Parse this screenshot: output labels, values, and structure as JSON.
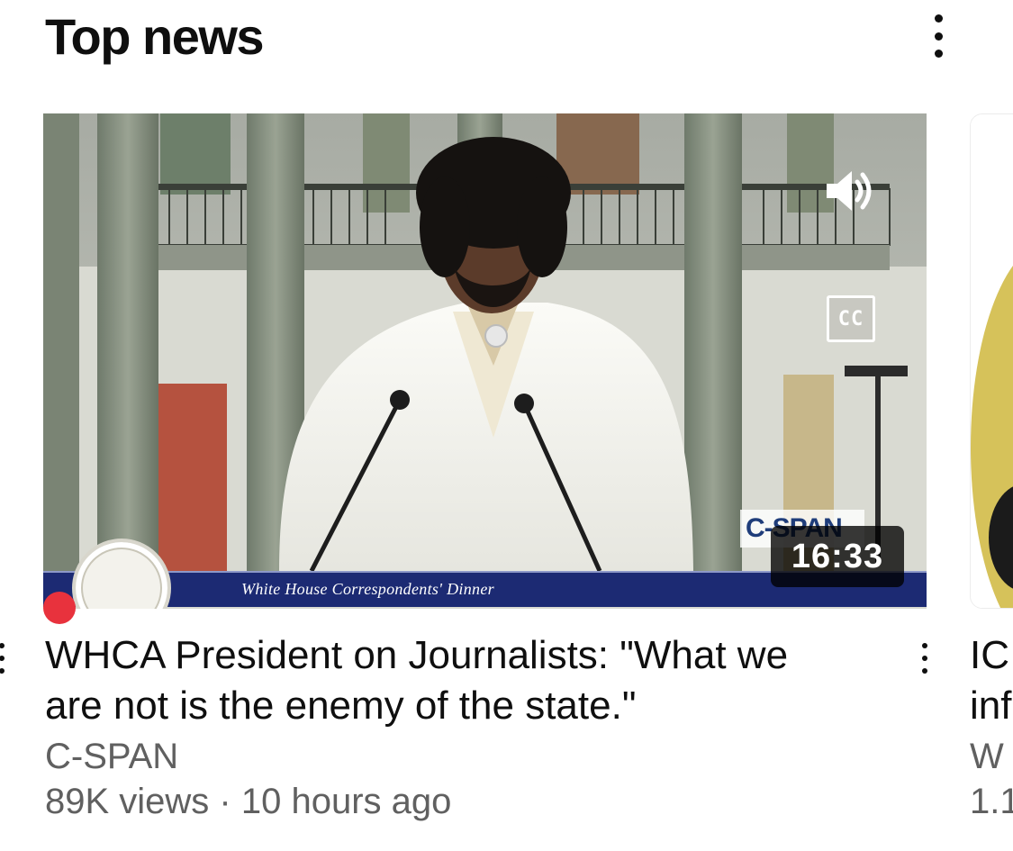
{
  "section": {
    "title": "Top news",
    "menu_icon": "more-vertical-icon"
  },
  "video": {
    "overlay_banner": "White House Correspondents' Dinner",
    "broadcaster_logo": "C-SPAN",
    "captions_label": "CC",
    "sound_icon": "speaker-icon",
    "duration": "16:33",
    "title": "WHCA President on Journalists: \"What we are not is the enemy of the state.\"",
    "channel": "C-SPAN",
    "views": "89K views",
    "separator": " · ",
    "age": "10 hours ago",
    "live_indicator_color": "#e8323d",
    "menu_icon": "more-vertical-icon"
  },
  "next_video": {
    "title_fragment": "IC\ninf",
    "channel_fragment": "W",
    "meta_fragment": "1.1"
  },
  "colors": {
    "text_primary": "#0f0f0f",
    "text_secondary": "#606060",
    "banner_blue": "#1c2a73"
  }
}
